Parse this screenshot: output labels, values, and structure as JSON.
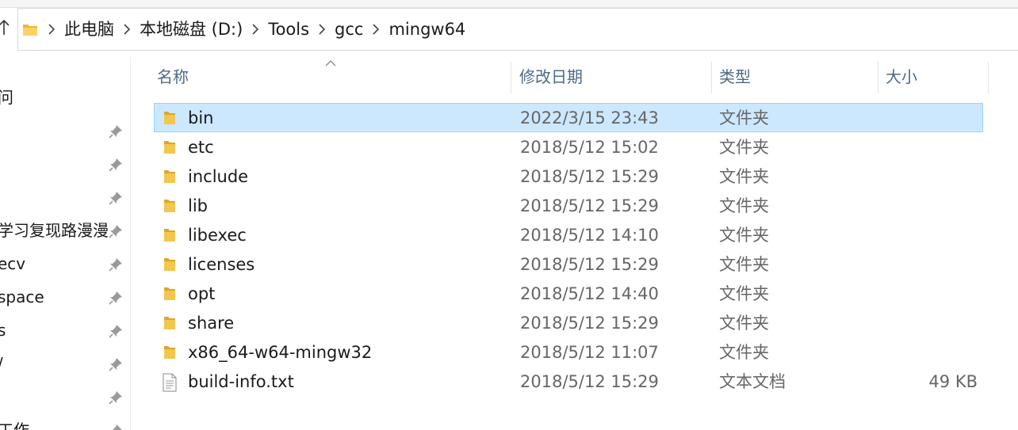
{
  "breadcrumb": [
    "此电脑",
    "本地磁盘 (D:)",
    "Tools",
    "gcc",
    "mingw64"
  ],
  "nav": {
    "items": [
      {
        "label": "问",
        "pinned": false
      },
      {
        "label": "",
        "pinned": true
      },
      {
        "label": "",
        "pinned": true
      },
      {
        "label": "",
        "pinned": true
      },
      {
        "label": "学习复现路漫漫",
        "pinned": true
      },
      {
        "label": "ecv",
        "pinned": true
      },
      {
        "label": "space",
        "pinned": true
      },
      {
        "label": "s",
        "pinned": true
      },
      {
        "label": "/",
        "pinned": true
      },
      {
        "label": "",
        "pinned": true
      },
      {
        "label": "工作",
        "pinned": true
      }
    ]
  },
  "columns": {
    "name": "名称",
    "date": "修改日期",
    "type": "类型",
    "size": "大小"
  },
  "files": [
    {
      "name": "bin",
      "date": "2022/3/15 23:43",
      "type": "文件夹",
      "size": "",
      "icon": "folder-icon",
      "selected": true
    },
    {
      "name": "etc",
      "date": "2018/5/12 15:02",
      "type": "文件夹",
      "size": "",
      "icon": "folder-icon",
      "selected": false
    },
    {
      "name": "include",
      "date": "2018/5/12 15:29",
      "type": "文件夹",
      "size": "",
      "icon": "folder-icon",
      "selected": false
    },
    {
      "name": "lib",
      "date": "2018/5/12 15:29",
      "type": "文件夹",
      "size": "",
      "icon": "folder-icon",
      "selected": false
    },
    {
      "name": "libexec",
      "date": "2018/5/12 14:10",
      "type": "文件夹",
      "size": "",
      "icon": "folder-icon",
      "selected": false
    },
    {
      "name": "licenses",
      "date": "2018/5/12 15:29",
      "type": "文件夹",
      "size": "",
      "icon": "folder-icon",
      "selected": false
    },
    {
      "name": "opt",
      "date": "2018/5/12 14:40",
      "type": "文件夹",
      "size": "",
      "icon": "folder-icon",
      "selected": false
    },
    {
      "name": "share",
      "date": "2018/5/12 15:29",
      "type": "文件夹",
      "size": "",
      "icon": "folder-icon",
      "selected": false
    },
    {
      "name": "x86_64-w64-mingw32",
      "date": "2018/5/12 11:07",
      "type": "文件夹",
      "size": "",
      "icon": "folder-icon",
      "selected": false
    },
    {
      "name": "build-info.txt",
      "date": "2018/5/12 15:29",
      "type": "文本文档",
      "size": "49 KB",
      "icon": "text-file-icon",
      "selected": false
    }
  ],
  "colors": {
    "selection": "#cce8ff",
    "selection_border": "#99d1ff",
    "folder": "#f3c64d",
    "header_text": "#4d6b8a"
  }
}
